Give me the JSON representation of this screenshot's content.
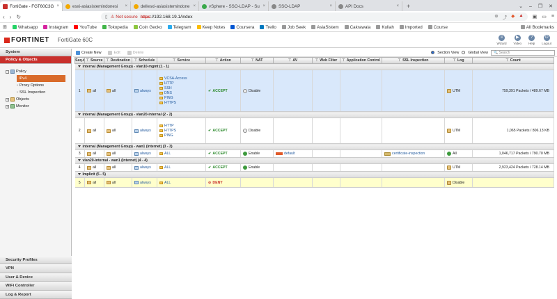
{
  "browser": {
    "tabs": [
      {
        "title": "FortiGate - FGT60C3G",
        "active": true,
        "color": "#c9302c"
      },
      {
        "title": "esxi-asiasistemindonesi",
        "active": false,
        "color": "#f2a900"
      },
      {
        "title": "dellesxi-asiasistemindone",
        "active": false,
        "color": "#f2a900"
      },
      {
        "title": "vSphere - SSO-LDAP - Su",
        "active": false,
        "color": "#3aa84a"
      },
      {
        "title": "SSO-LDAP",
        "active": false,
        "color": "#888888"
      },
      {
        "title": "API Docs",
        "active": false,
        "color": "#888888"
      }
    ],
    "new_tab": "+",
    "window_controls": [
      "⌄",
      "–",
      "❐",
      "✕"
    ],
    "address": {
      "warning": "Not secure",
      "scheme": "https",
      "rest": "://192.168.19.1/index"
    },
    "bookmarks": [
      {
        "label": "Whatsapp",
        "color": "#25d366"
      },
      {
        "label": "Instagram",
        "color": "#d6249f"
      },
      {
        "label": "YouTube",
        "color": "#ff0000"
      },
      {
        "label": "Tokopedia",
        "color": "#42b549"
      },
      {
        "label": "Coin Gecko",
        "color": "#8dc63f"
      },
      {
        "label": "Telegram",
        "color": "#2aabee"
      },
      {
        "label": "Keep Notes",
        "color": "#fbbc04"
      },
      {
        "label": "Coursera",
        "color": "#0056d2"
      },
      {
        "label": "Trello",
        "color": "#0079bf"
      },
      {
        "label": "Job Seek",
        "color": "#999999"
      },
      {
        "label": "AsiaSistem",
        "color": "#999999"
      },
      {
        "label": "Cakrawala",
        "color": "#999999"
      },
      {
        "label": "Kuliah",
        "color": "#999999"
      },
      {
        "label": "Imported",
        "color": "#999999"
      },
      {
        "label": "Course",
        "color": "#999999"
      }
    ],
    "all_bookmarks": "All Bookmarks"
  },
  "header": {
    "logo": "FORTINET",
    "model": "FortiGate 60C",
    "icons": [
      {
        "label": "Wizard",
        "glyph": "≡"
      },
      {
        "label": "Video",
        "glyph": "▶"
      },
      {
        "label": "Help",
        "glyph": "?"
      },
      {
        "label": "Logout",
        "glyph": "⏻"
      }
    ]
  },
  "sidebar": {
    "top_sections": [
      "System",
      "Policy & Objects"
    ],
    "active_section": "Policy & Objects",
    "tree": {
      "policy": "Policy",
      "ipv4": "IPv4",
      "proxy": "Proxy Options",
      "ssl": "SSL Inspection",
      "objects": "Objects",
      "monitor": "Monitor"
    },
    "bottom_sections": [
      "Security Profiles",
      "VPN",
      "User & Device",
      "WiFi Controller",
      "Log & Report"
    ]
  },
  "toolbar": {
    "create": "Create New",
    "edit": "Edit",
    "delete": "Delete",
    "section_view": "Section View",
    "global_view": "Global View",
    "search_placeholder": "Search"
  },
  "table": {
    "headers": [
      "Seq.#",
      "Source",
      "Destination",
      "Schedule",
      "Service",
      "Action",
      "NAT",
      "AV",
      "Web Filter",
      "Application Control",
      "SSL Inspection",
      "Log",
      "Count"
    ],
    "groups": [
      {
        "title": "internal (Management Group) - vlan10-mgmt (1 - 1)",
        "rules": [
          {
            "seq": "1",
            "src": "all",
            "dst": "all",
            "schedule": "always",
            "services": [
              "VCSA-Access",
              "HTTP",
              "SSH",
              "DNS",
              "PING",
              "HTTPS"
            ],
            "action": "ACCEPT",
            "nat": "Disable",
            "av": "",
            "ssl": "",
            "log": "UTM",
            "count": "759,391 Packets / 489.67 MB",
            "style": "sel"
          }
        ]
      },
      {
        "title": "internal (Management Group) - vlan20-internal (2 - 2)",
        "rules": [
          {
            "seq": "2",
            "src": "all",
            "dst": "all",
            "schedule": "always",
            "services": [
              "HTTP",
              "HTTPS",
              "PING"
            ],
            "action": "ACCEPT",
            "nat": "Disable",
            "av": "",
            "ssl": "",
            "log": "UTM",
            "count": "1,065 Packets / 806.13 KB",
            "style": "normal"
          }
        ]
      },
      {
        "title": "internal (Management Group) - wan1 (Internet) (3 - 3)",
        "rules": [
          {
            "seq": "3",
            "src": "all",
            "dst": "all",
            "schedule": "always",
            "services": [
              "ALL"
            ],
            "action": "ACCEPT",
            "nat": "Enable",
            "av": "default",
            "ssl": "certificate-inspection",
            "log": "All",
            "count": "1,046,717 Packets / 790.70 MB",
            "style": "normal"
          }
        ]
      },
      {
        "title": "vlan20-internal - wan1 (Internet) (4 - 4)",
        "rules": [
          {
            "seq": "4",
            "src": "all",
            "dst": "all",
            "schedule": "always",
            "services": [
              "ALL"
            ],
            "action": "ACCEPT",
            "nat": "Enable",
            "av": "",
            "ssl": "",
            "log": "UTM",
            "count": "2,923,424 Packets / 728.14 MB",
            "style": "normal"
          }
        ]
      },
      {
        "title": "Implicit (5 - 5)",
        "rules": [
          {
            "seq": "5",
            "src": "all",
            "dst": "all",
            "schedule": "always",
            "services": [
              "ALL"
            ],
            "action": "DENY",
            "nat": "",
            "av": "",
            "ssl": "",
            "log": "Disable",
            "count": "",
            "style": "implicit"
          }
        ]
      }
    ]
  }
}
